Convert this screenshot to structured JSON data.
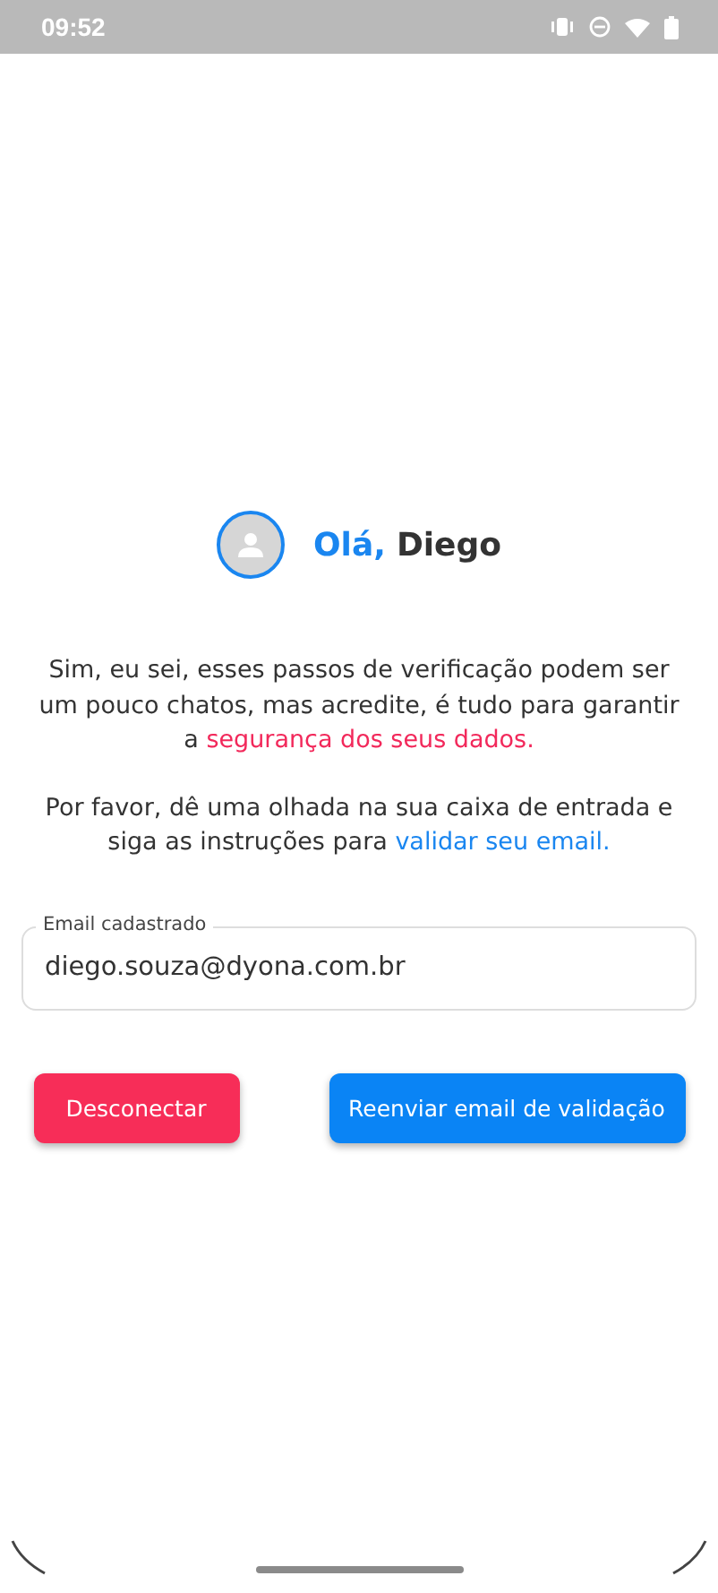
{
  "status_bar": {
    "time": "09:52"
  },
  "greeting": {
    "salutation": "Olá,",
    "name": "Diego"
  },
  "paragraphs": [
    {
      "segments": [
        {
          "kind": "plain",
          "text": "Sim, eu sei, esses passos de verificação podem ser um pouco chatos, mas acredite, é tudo para garantir a "
        },
        {
          "kind": "emphasis",
          "text": "segurança dos seus dados."
        }
      ]
    },
    {
      "segments": [
        {
          "kind": "plain",
          "text": "Por favor, dê uma olhada na sua caixa de entrada e siga as instruções para "
        },
        {
          "kind": "link",
          "text": "validar seu email."
        }
      ]
    }
  ],
  "email_field": {
    "label": "Email cadastrado",
    "value": "diego.souza@dyona.com.br"
  },
  "buttons": [
    {
      "kind": "danger",
      "label": "Desconectar"
    },
    {
      "kind": "primary",
      "label": "Reenviar email de validação"
    }
  ]
}
